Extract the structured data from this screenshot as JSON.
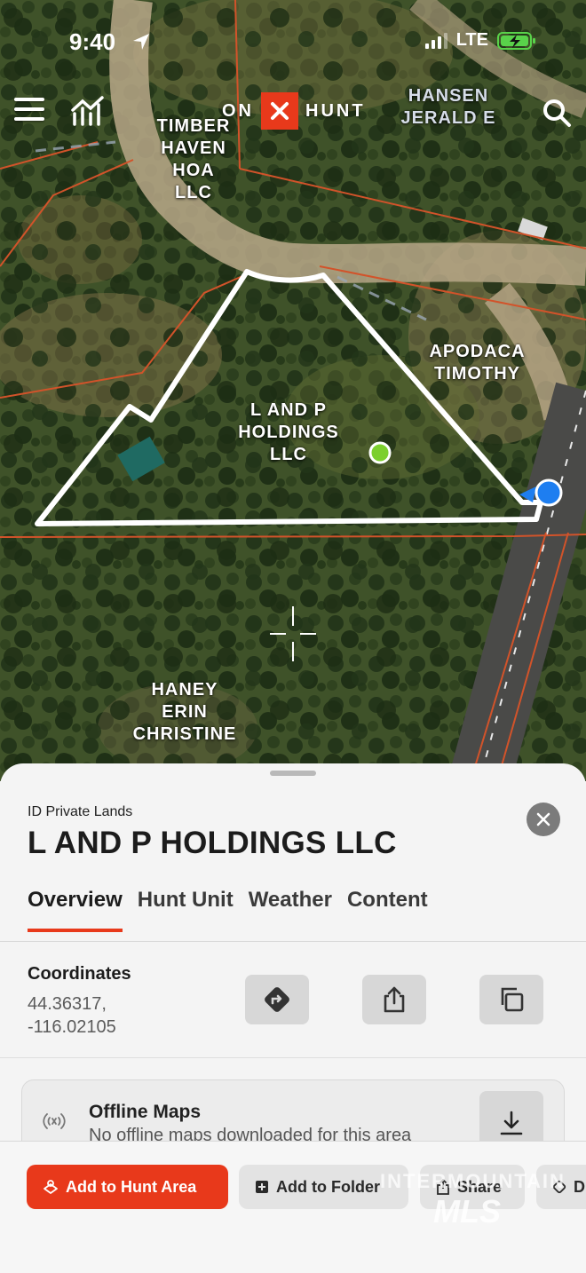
{
  "status_bar": {
    "time": "9:40",
    "network": "LTE"
  },
  "header": {
    "logo_left": "ON",
    "logo_right": "HUNT"
  },
  "map": {
    "labels": {
      "timber": "TIMBER\nHAVEN\nHOA\nLLC",
      "hansen": "HANSEN\nJERALD E",
      "apodaca": "APODACA\nTIMOTHY",
      "lp": "L AND P\nHOLDINGS\nLLC",
      "haney": "HANEY\nERIN\nCHRISTINE"
    }
  },
  "sheet": {
    "subtitle": "ID Private Lands",
    "title": "L AND P HOLDINGS LLC",
    "tabs": [
      {
        "label": "Overview",
        "active": true
      },
      {
        "label": "Hunt Unit",
        "active": false
      },
      {
        "label": "Weather",
        "active": false
      },
      {
        "label": "Content",
        "active": false
      }
    ],
    "coordinates": {
      "label": "Coordinates",
      "lat": "44.36317,",
      "lon": "-116.02105"
    },
    "offline": {
      "title": "Offline Maps",
      "description": "No offline maps downloaded for this area"
    }
  },
  "actions": {
    "add_hunt_area": "Add to Hunt Area",
    "add_folder": "Add to Folder",
    "share": "Share",
    "next": "D"
  },
  "watermark": {
    "line1": "INTERMOUNTAIN",
    "line2": "MLS"
  },
  "colors": {
    "accent": "#e8391b",
    "boundary": "#ffffff",
    "parcel_lines": "#d2532a",
    "user_location": "#1e7ef0",
    "pin": "#7ccf2e"
  }
}
